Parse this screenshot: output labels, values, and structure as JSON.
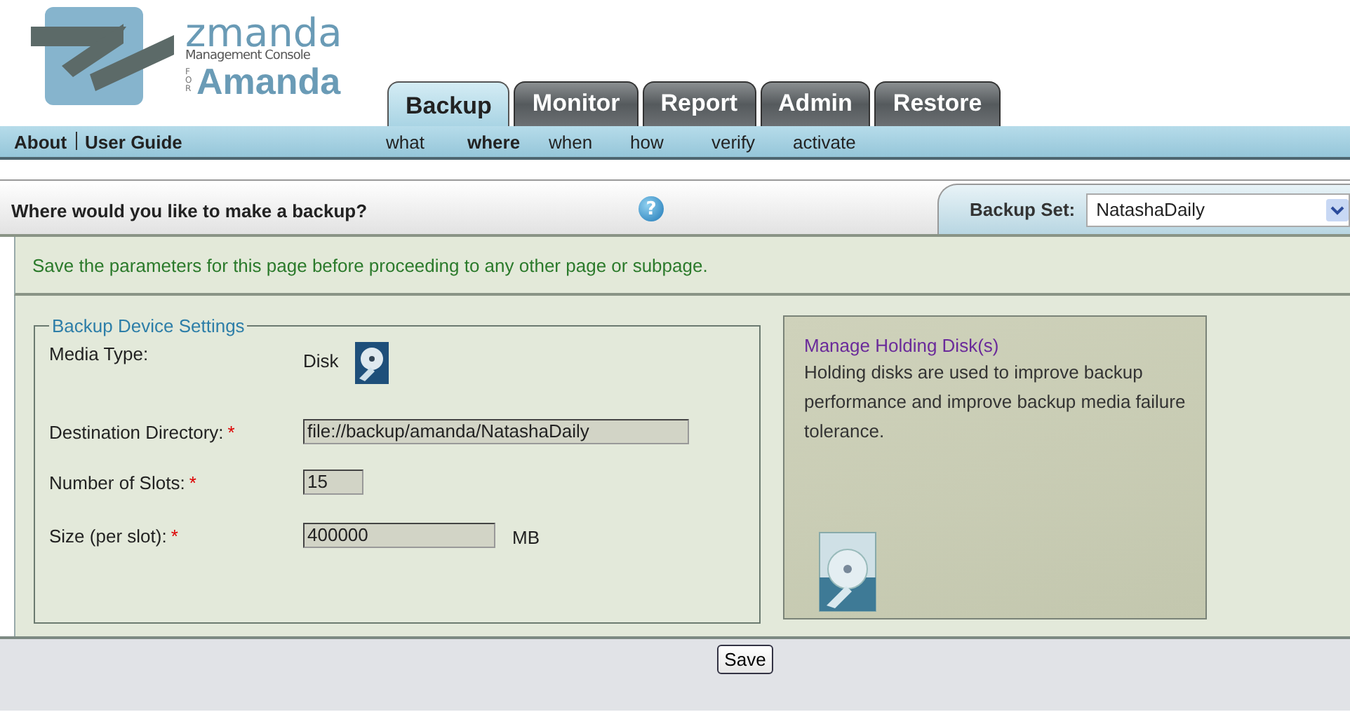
{
  "logo": {
    "brand": "zmanda",
    "subtitle": "Management Console",
    "prefix": "FOR",
    "product": "Amanda"
  },
  "tabs": [
    {
      "label": "Backup",
      "selected": true
    },
    {
      "label": "Monitor",
      "selected": false
    },
    {
      "label": "Report",
      "selected": false
    },
    {
      "label": "Admin",
      "selected": false
    },
    {
      "label": "Restore",
      "selected": false
    }
  ],
  "nav": {
    "links": [
      "About",
      "User Guide"
    ],
    "steps": [
      {
        "label": "what",
        "selected": false
      },
      {
        "label": "where",
        "selected": true
      },
      {
        "label": "when",
        "selected": false
      },
      {
        "label": "how",
        "selected": false
      },
      {
        "label": "verify",
        "selected": false
      },
      {
        "label": "activate",
        "selected": false
      }
    ]
  },
  "header": {
    "title": "Where would you like to make a backup?",
    "help": "?"
  },
  "backup_set": {
    "label": "Backup Set:",
    "value": "NatashaDaily"
  },
  "notice": "Save the parameters for this page before proceeding to any other page or subpage.",
  "device_settings": {
    "legend": "Backup Device Settings",
    "fields": [
      {
        "kind": "media",
        "label": "Media Type:",
        "value": "Disk"
      },
      {
        "kind": "input",
        "label": "Destination Directory:",
        "required_mark": "*",
        "value": "file://backup/amanda/NatashaDaily"
      },
      {
        "kind": "input",
        "label": "Number of Slots:",
        "required_mark": "*",
        "value": "15"
      },
      {
        "kind": "input",
        "label": "Size (per slot):",
        "required_mark": "*",
        "value": "400000",
        "unit": "MB"
      }
    ]
  },
  "holding_disk": {
    "title": "Manage Holding Disk(s)",
    "description": "Holding disks are used to improve backup performance and improve backup media failure tolerance."
  },
  "footer": {
    "save": "Save"
  }
}
